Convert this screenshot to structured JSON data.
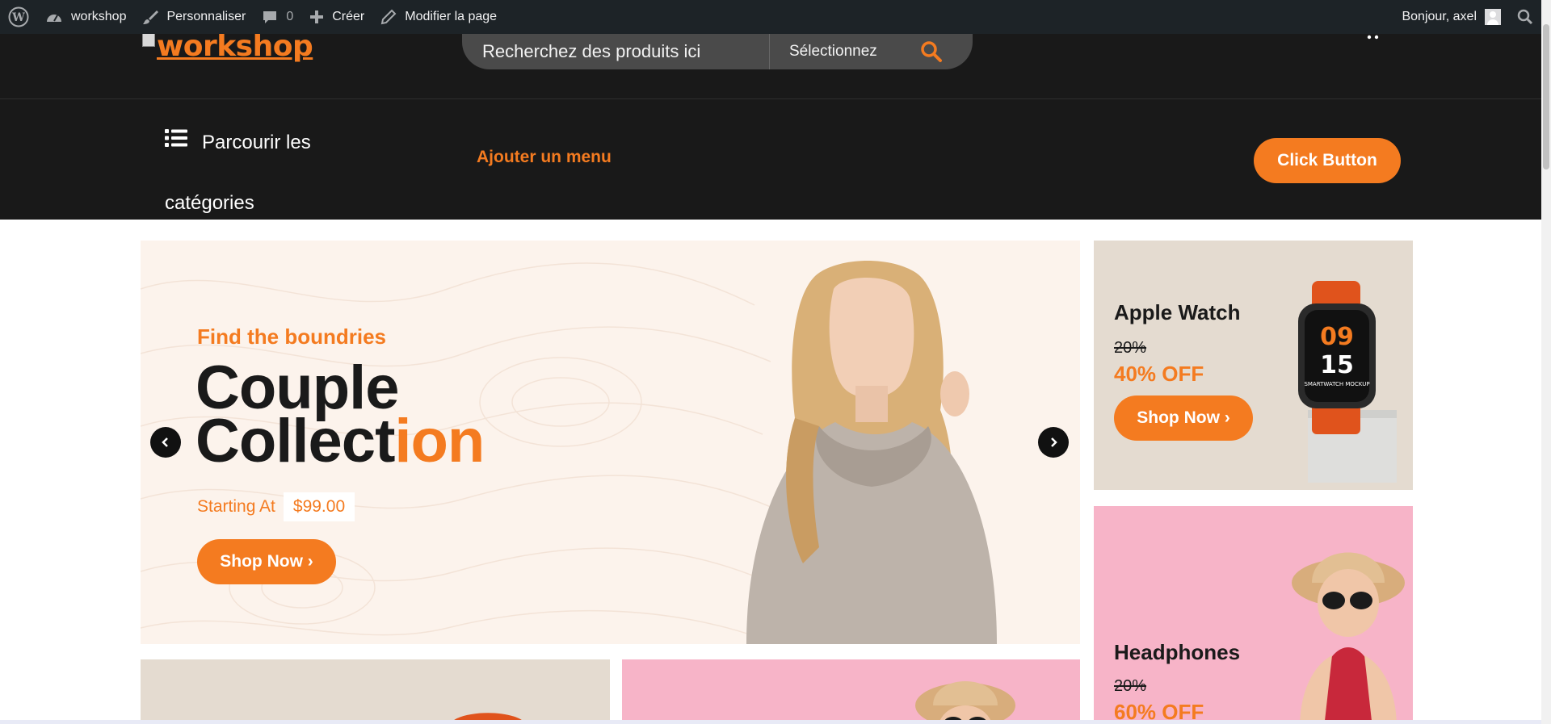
{
  "admin_bar": {
    "site_name": "workshop",
    "customize": "Personnaliser",
    "comments_count": "0",
    "new": "Créer",
    "edit_page": "Modifier la page",
    "greeting": "Bonjour, axel",
    "icons": [
      "wordpress-icon",
      "dashboard-icon",
      "brush-icon",
      "comment-icon",
      "plus-icon",
      "pencil-icon",
      "user-icon",
      "search-icon"
    ]
  },
  "header": {
    "logo_text": "workshop",
    "search_placeholder": "Recherchez des produits ici",
    "category_select": "Sélectionnez",
    "icons": [
      "search-icon",
      "cart-icon"
    ]
  },
  "nav": {
    "browse_label": "Parcourir les catégories",
    "add_menu": "Ajouter un menu",
    "click_button": "Click Button"
  },
  "hero": {
    "kicker": "Find the boundries",
    "title_part1": "Couple",
    "title_part2": "Collect",
    "title_accent": "ion",
    "starting_label": "Starting At",
    "price": "$99.00",
    "shop_label": "Shop Now ›"
  },
  "side_banners": [
    {
      "title": "Apple Watch",
      "old": "20%",
      "off": "40% OFF",
      "shop_label": "Shop Now ›",
      "watch_hour": "09",
      "watch_min": "15",
      "watch_caption": "SMARTWATCH MOCKUP"
    },
    {
      "title": "Headphones",
      "old": "20%",
      "off": "60% OFF"
    }
  ],
  "colors": {
    "accent": "#f47b20",
    "header_bg": "#191919",
    "adminbar_bg": "#1d2327",
    "hero_bg": "#fcf3ec",
    "banner_beige": "#e4dbd0",
    "banner_pink": "#f7b4c8"
  }
}
